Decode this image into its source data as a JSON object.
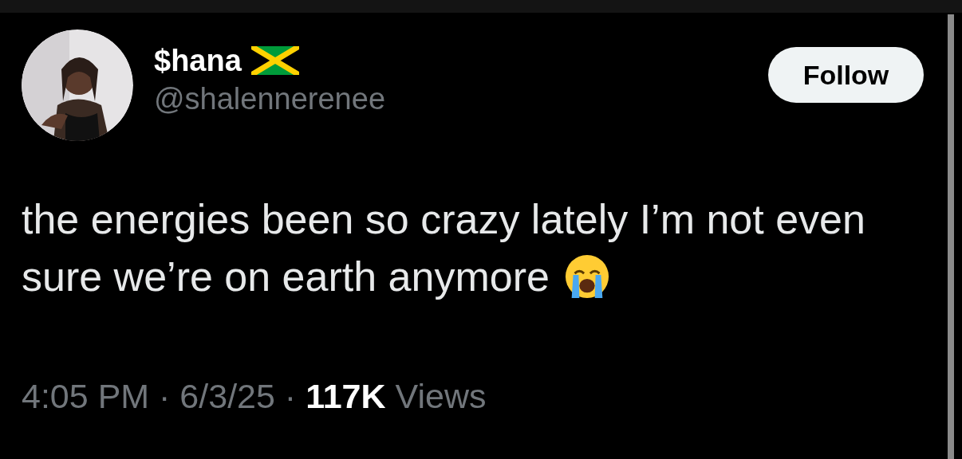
{
  "author": {
    "name": "$hana",
    "handle": "@shalennerenee"
  },
  "follow_button": {
    "label": "Follow"
  },
  "post": {
    "lines": [
      "the energies been so crazy lately I’m not even",
      "sure we’re on earth anymore"
    ]
  },
  "meta": {
    "text": "4:05 PM · 6/3/25 · **117K** Views"
  }
}
